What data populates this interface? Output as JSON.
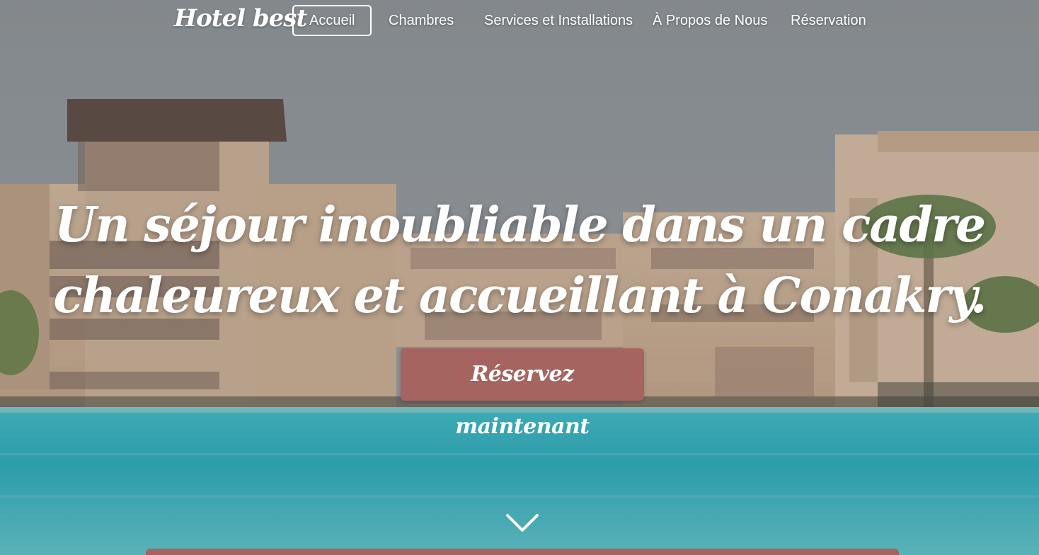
{
  "brand": {
    "name": "Hotel best"
  },
  "nav": {
    "items": [
      {
        "label": "Accueil",
        "active": true
      },
      {
        "label": "Chambres",
        "active": false
      },
      {
        "label": "Services et Installations",
        "active": false
      },
      {
        "label": "À Propos de Nous",
        "active": false
      },
      {
        "label": "Réservation",
        "active": false
      }
    ]
  },
  "hero": {
    "headline_line1": "Un séjour inoubliable dans un cadre",
    "headline_line2": "chaleureux et accueillant à Conakry.",
    "cta_label": "Réservez maintenant",
    "scroll_icon": "chevron-down-icon"
  },
  "colors": {
    "accent": "#a56460",
    "nav_text": "#ffffff",
    "sky": "#8d9398",
    "water": "#2fb0bf"
  }
}
